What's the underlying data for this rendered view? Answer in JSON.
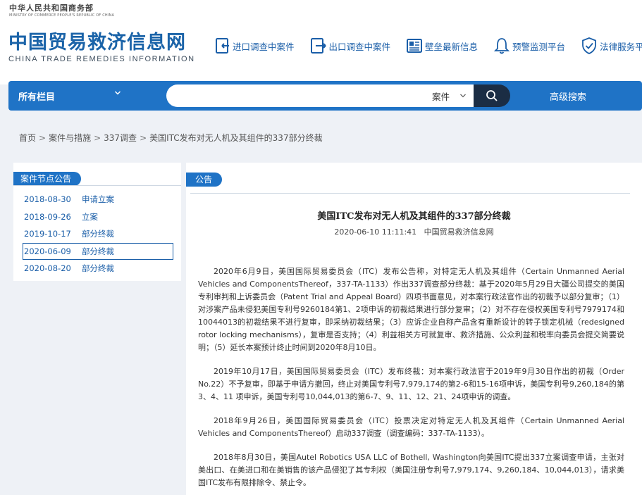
{
  "ministry": {
    "cn": "中华人民共和国商务部",
    "en": "MINISTRY OF COMMERCE PEOPLE'S REPUBLIC OF CHINA"
  },
  "logo": {
    "cn": "中国贸易救济信息网",
    "en": "CHINA TRADE REMEDIES INFORMATION"
  },
  "nav": [
    {
      "label": "进口调查中案件",
      "icon": "import-investigation-icon"
    },
    {
      "label": "出口调查中案件",
      "icon": "export-investigation-icon"
    },
    {
      "label": "壁垒最新信息",
      "icon": "barrier-news-icon"
    },
    {
      "label": "预警监测平台",
      "icon": "bell-icon"
    },
    {
      "label": "法律服务平台",
      "icon": "shield-check-icon"
    }
  ],
  "searchbar": {
    "all_columns": "所有栏目",
    "placeholder": "",
    "select_value": "案件",
    "advanced": "高级搜索"
  },
  "breadcrumb": [
    "首页",
    "案件与措施",
    "337调查",
    "美国ITC发布对无人机及其组件的337部分终裁"
  ],
  "sidebar": {
    "title": "案件节点公告",
    "items": [
      {
        "date": "2018-08-30",
        "label": "申请立案"
      },
      {
        "date": "2018-09-26",
        "label": "立案"
      },
      {
        "date": "2019-10-17",
        "label": "部分终裁"
      },
      {
        "date": "2020-06-09",
        "label": "部分终裁"
      },
      {
        "date": "2020-08-20",
        "label": "部分终裁"
      }
    ]
  },
  "main": {
    "tag": "公告",
    "title": "美国ITC发布对无人机及其组件的337部分终裁",
    "meta": "2020-06-10 11:11:41   中国贸易救济信息网",
    "paragraphs": [
      "2020年6月9日，美国国际贸易委员会（ITC）发布公告称，对特定无人机及其组件（Certain Unmanned Aerial Vehicles and ComponentsThereof，337-TA-1133）作出337调查部分终裁：基于2020年5月29日大疆公司提交的美国专利审判和上诉委员会（Patent Trial and Appeal Board）四项书面意见，对本案行政法官作出的初裁予以部分复审；（1）对涉案产品未侵犯美国专利号9260184第1、2项申诉的初裁结果进行部分复审；（2）对不存在侵权美国专利号7979174和10044013的初裁结果不进行复审，即采纳初裁结果；（3）应诉企业自称产品含有重新设计的转子锁定机械（redesigned rotor locking mechanisms），复审是否支持；（4）利益相关方可就复审、救济措施、公众利益和税率向委员会提交简要说明；（5）延长本案预计终止时间到2020年8月10日。",
      "2019年10月17日，美国国际贸易委员会（ITC）发布终裁：对本案行政法官于2019年9月30日作出的初裁（Order No.22）不予复审，即基于申请方撤回，终止对美国专利号7,979,174的第2-6和15-16项申诉，美国专利号9,260,184的第3、4、11 项申诉，美国专利号10,044,013的第6-7、9、11、12、21、24项申诉的调查。",
      "2018年9月26日，美国国际贸易委员会（ITC）投票决定对特定无人机及其组件（Certain Unmanned Aerial Vehicles and ComponentsThereof）启动337调查（调查编码：337-TA-1133）。",
      "2018年8月30日，美国Autel Robotics USA LLC of Bothell, Washington向美国ITC提出337立案调查申请，主张对美出口、在美进口和在美销售的该产品侵犯了其专利权（美国注册专利号7,979,174、9,260,184、10,044,013），请求美国ITC发布有限排除令、禁止令。"
    ]
  },
  "colors": {
    "brand_blue": "#1f73c6",
    "search_button": "#1b2d44",
    "link_blue": "#1a5ea8"
  }
}
